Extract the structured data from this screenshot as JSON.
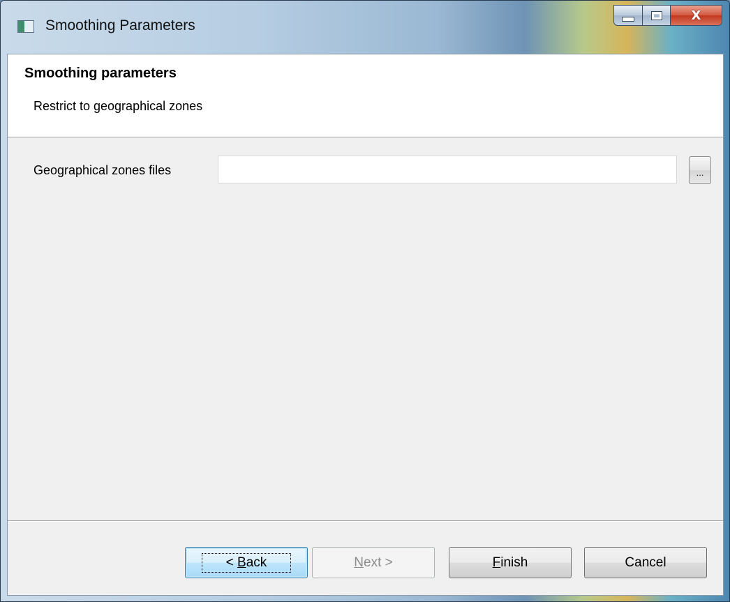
{
  "window": {
    "title": "Smoothing Parameters",
    "close_glyph": "X"
  },
  "header": {
    "title": "Smoothing parameters",
    "subtitle": "Restrict to geographical zones"
  },
  "form": {
    "zones_label": "Geographical zones files",
    "zones_value": "",
    "browse_label": "..."
  },
  "buttons": {
    "back_prefix": "< ",
    "back_mnemonic": "B",
    "back_rest": "ack",
    "next_mnemonic": "N",
    "next_rest": "ext >",
    "finish_mnemonic": "F",
    "finish_rest": "inish",
    "cancel": "Cancel"
  },
  "icons": {
    "app": "window-app-icon",
    "minimize": "minimize-icon",
    "maximize": "maximize-icon",
    "close": "close-icon"
  },
  "colors": {
    "client_bg": "#f0f0f0",
    "header_bg": "#ffffff",
    "default_button_border": "#3c7fb1",
    "close_button": "#c2391f"
  }
}
